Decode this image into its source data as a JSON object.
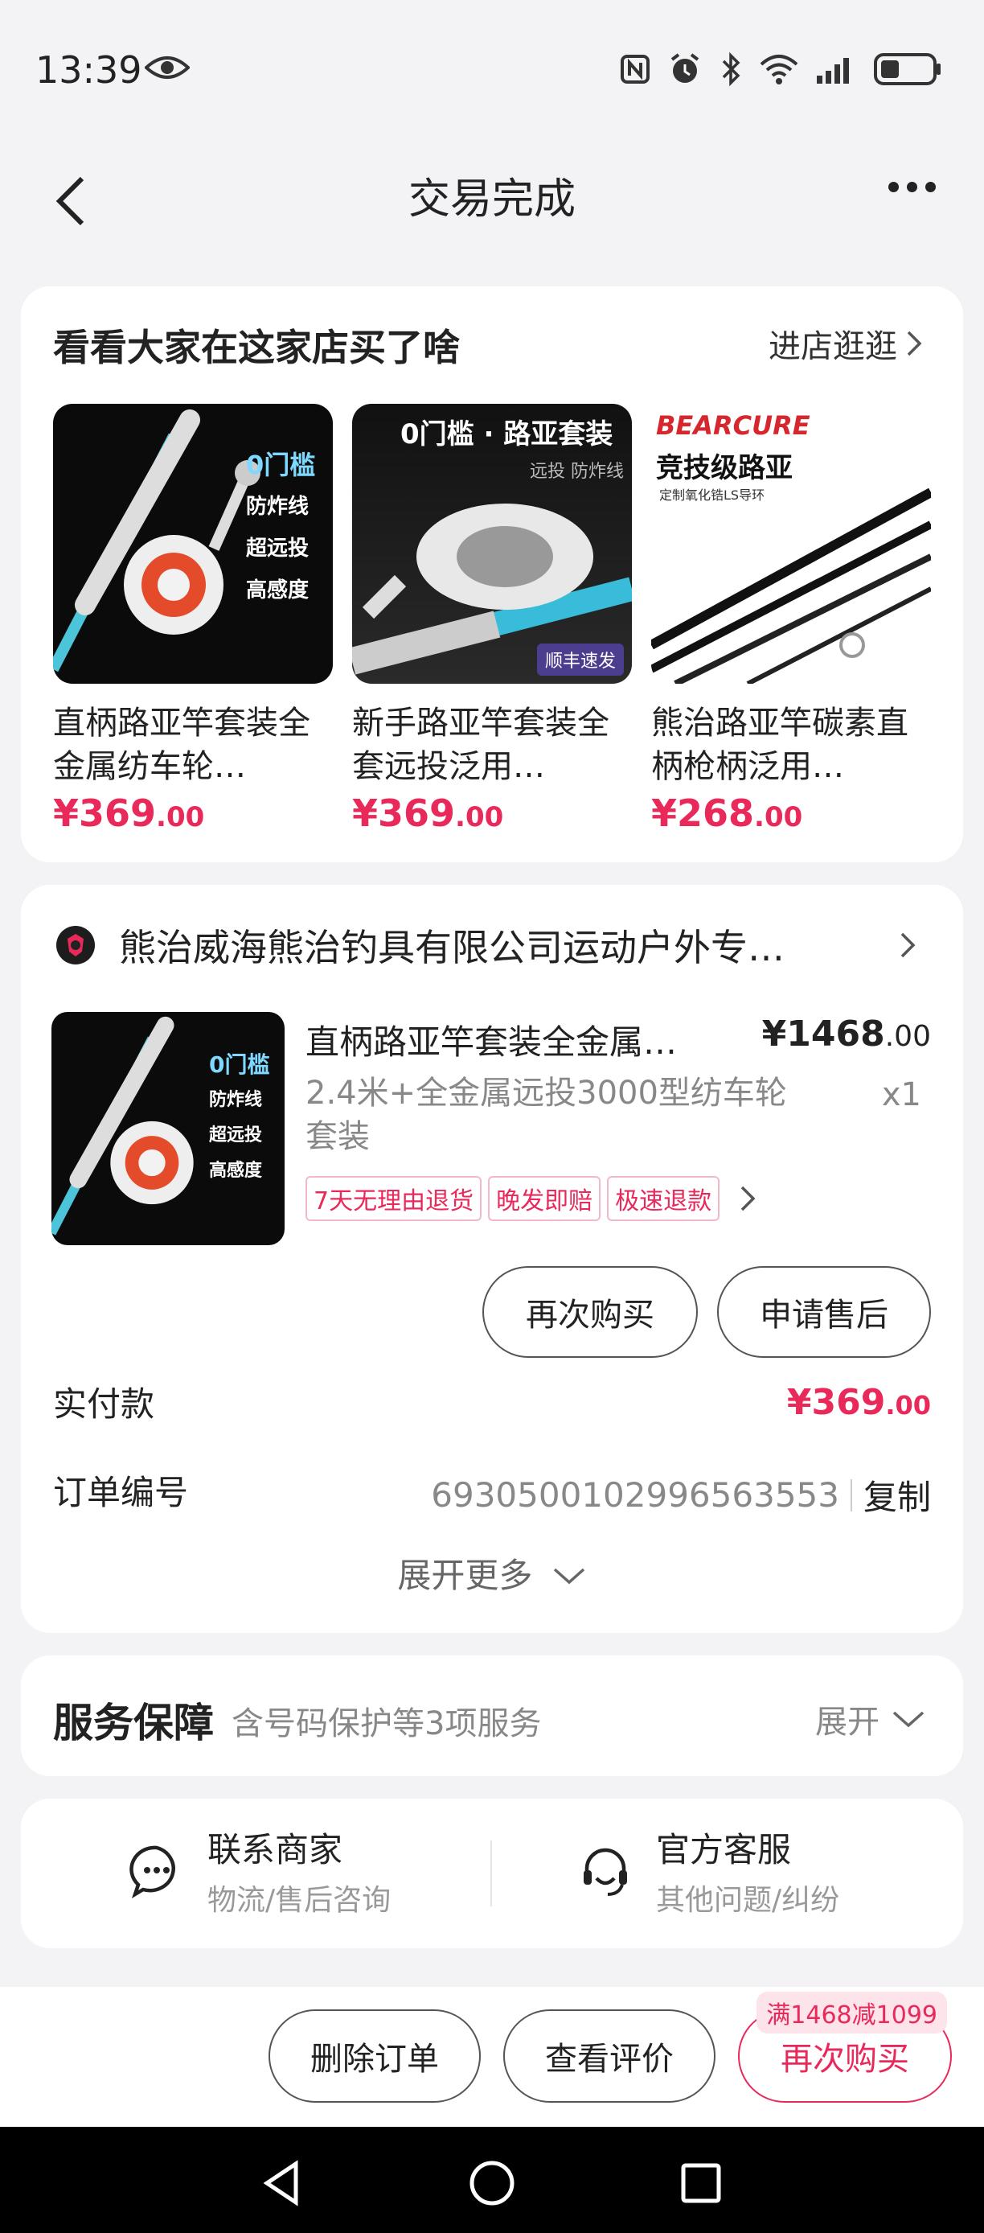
{
  "status_bar": {
    "time": "13:39"
  },
  "nav": {
    "title": "交易完成"
  },
  "recommend": {
    "heading": "看看大家在这家店买了啥",
    "enter_shop": "进店逛逛",
    "products": [
      {
        "name": "直柄路亚竿套装全金属纺车轮…",
        "price_int": "¥369",
        "price_dec": ".00",
        "badges": [
          "0门槛",
          "防炸线",
          "超远投",
          "高感度"
        ]
      },
      {
        "name": "新手路亚竿套装全套远投泛用…",
        "price_int": "¥369",
        "price_dec": ".00",
        "banner": "0门槛 · 路亚套装",
        "banner_sub": "远投 防炸线",
        "shipping": "顺丰速发"
      },
      {
        "name": "熊治路亚竿碳素直柄枪柄泛用…",
        "price_int": "¥268",
        "price_dec": ".00",
        "brand": "BEARCURE",
        "brand_sub": "竞技级路亚",
        "brand_sub2": "定制氧化锆LS导环"
      }
    ]
  },
  "order": {
    "shop_name": "熊治威海熊治钓具有限公司运动户外专…",
    "item_title": "直柄路亚竿套装全金属…",
    "item_price_int": "¥1468",
    "item_price_dec": ".00",
    "item_spec": "2.4米+全金属远投3000型纺车轮套装",
    "item_qty": "x1",
    "tags": [
      "7天无理由退货",
      "晚发即赔",
      "极速退款"
    ],
    "img_badges": [
      "0门槛",
      "防炸线",
      "超远投",
      "高感度"
    ],
    "btn_rebuy": "再次购买",
    "btn_aftersale": "申请售后",
    "paid_label": "实付款",
    "paid_int": "¥369",
    "paid_dec": ".00",
    "order_no_label": "订单编号",
    "order_no": "6930500102996563553",
    "copy": "复制",
    "expand_more": "展开更多"
  },
  "service": {
    "title": "服务保障",
    "sub": "含号码保护等3项服务",
    "expand": "展开"
  },
  "contact": {
    "merchant_title": "联系商家",
    "merchant_sub": "物流/售后咨询",
    "official_title": "官方客服",
    "official_sub": "其他问题/纠纷"
  },
  "bottom": {
    "delete": "删除订单",
    "review": "查看评价",
    "rebuy": "再次购买",
    "promo": "满1468减1099"
  },
  "colors": {
    "accent": "#e8295a",
    "background": "#f3f3f5"
  }
}
